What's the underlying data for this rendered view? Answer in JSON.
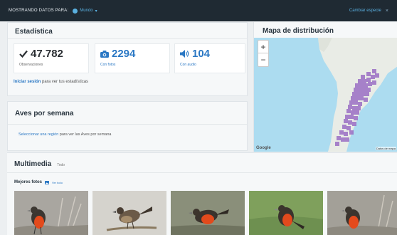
{
  "topbar": {
    "showing_label": "MOSTRANDO DATOS PARA:",
    "region_label": "Mundo",
    "change_species_label": "Cambiar especie",
    "close_symbol": "×",
    "chevron": "▾"
  },
  "stats": {
    "title": "Estadística",
    "observations": {
      "value": "47.782",
      "label": "Observaciones"
    },
    "photos": {
      "value": "2294",
      "label": "Con fotos"
    },
    "audio": {
      "value": "104",
      "label": "Con audio"
    },
    "signin_link": "Iniciar sesión",
    "signin_text": " para ver tus estadísticas"
  },
  "weekly": {
    "title": "Aves por semana",
    "select_link": "Seleccionar una región",
    "hint_text": " para ver las Aves por semana"
  },
  "map": {
    "title": "Mapa de distribución",
    "zoom_in": "+",
    "zoom_out": "−",
    "logo": "Google",
    "terms": "Datos de mapa"
  },
  "multimedia": {
    "title": "Multimedia",
    "all_label": "Todo",
    "best_photos": "Mejores fotos",
    "see_all": "Ver todo"
  },
  "colors": {
    "topbar": "#1f2a33",
    "accent": "#2b78c4",
    "range_fill": "#9b6fc4"
  }
}
